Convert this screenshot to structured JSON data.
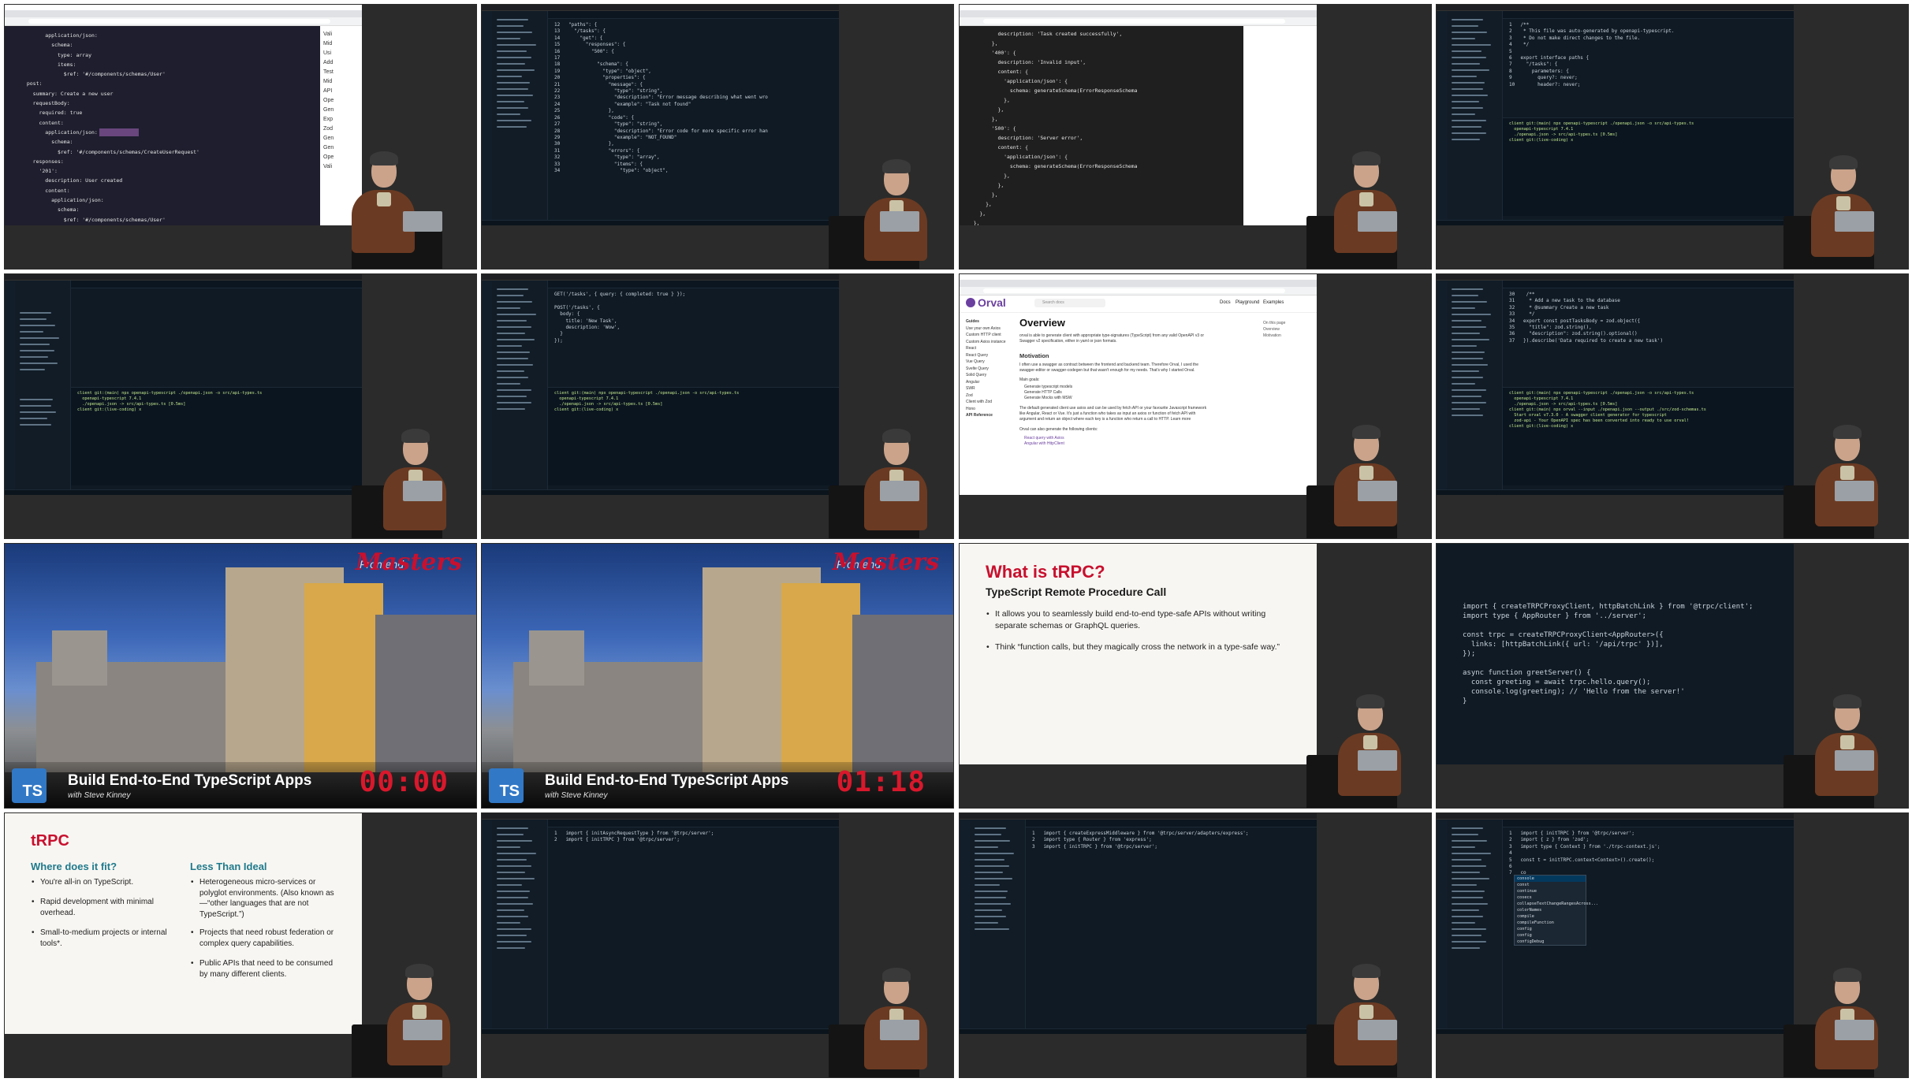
{
  "tiles": {
    "t1": {
      "code": [
        "        application/json:",
        "          schema:",
        "            type: array",
        "            items:",
        "              $ref: '#/components/schemas/User'",
        "  post:",
        "    summary: Create a new user",
        "    requestBody:",
        "      required: true",
        "      content:",
        "        application/json:",
        "          schema:",
        "            $ref: '#/components/schemas/CreateUserRequest'",
        "    responses:",
        "      '201':",
        "        description: User created",
        "        content:",
        "          application/json:",
        "            schema:",
        "              $ref: '#/components/schemas/User'"
      ],
      "side_labels": [
        "Vali",
        "Mid",
        "Usi",
        "Add",
        "Test",
        "Mid",
        "API",
        "Ope",
        "Gen",
        "Exp",
        "Zod",
        "Gen",
        "Gen",
        "Ope",
        "Vali"
      ]
    },
    "t2": {
      "code": [
        "12   \"paths\": {",
        "13     \"/tasks\": {",
        "14       \"get\": {",
        "15         \"responses\": {",
        "16           \"500\": {",
        "17",
        "18             \"schema\": {",
        "19               \"type\": \"object\",",
        "20               \"properties\": {",
        "21                 \"message\": {",
        "22                   \"type\": \"string\",",
        "23                   \"description\": \"Error message describing what went wro",
        "24                   \"example\": \"Task not found\"",
        "25                 },",
        "26                 \"code\": {",
        "27                   \"type\": \"string\",",
        "28                   \"description\": \"Error code for more specific error han",
        "29                   \"example\": \"NOT_FOUND\"",
        "30                 },",
        "31                 \"errors\": {",
        "32                   \"type\": \"array\",",
        "33                   \"items\": {",
        "34                     \"type\": \"object\","
      ]
    },
    "t3": {
      "code": [
        "          description: 'Task created successfully',",
        "        },",
        "        '400': {",
        "          description: 'Invalid input',",
        "          content: {",
        "            'application/json': {",
        "              schema: generateSchema(ErrorResponseSchema",
        "            },",
        "          },",
        "        },",
        "        '500': {",
        "          description: 'Server error',",
        "          content: {",
        "            'application/json': {",
        "              schema: generateSchema(ErrorResponseSchema",
        "            },",
        "          },",
        "        },",
        "      },",
        "    },",
        "  },"
      ]
    },
    "t4": {
      "code": [
        "1   /**",
        "2    * This file was auto-generated by openapi-typescript.",
        "3    * Do not make direct changes to the file.",
        "4    */",
        "5",
        "6   export interface paths {",
        "7     \"/tasks\": {",
        "8       parameters: {",
        "9         query?: never;",
        "10        header?: never;"
      ],
      "terminal": [
        "client git:(main) npx openapi-typescript ./openapi.json -o src/api-types.ts",
        "  openapi-typescript 7.4.1",
        "  ./openapi.json -> src/api-types.ts [0.5ms]",
        "client git:(live-coding) x"
      ]
    },
    "t5": {
      "terminal": [
        "client git:(main) npx openapi-typescript ./openapi.json -o src/api-types.ts",
        "  openapi-typescript 7.4.1",
        "  ./openapi.json -> src/api-types.ts [0.5ms]",
        "client git:(live-coding) x"
      ]
    },
    "t6": {
      "code": [
        "GET('/tasks', { query: { completed: true } });",
        "",
        "POST('/tasks', {",
        "  body: {",
        "    title: 'New Task',",
        "    description: 'Wow',",
        "  }",
        "});"
      ],
      "terminal": [
        "client git:(main) npx openapi-typescript ./openapi.json -o src/api-types.ts",
        "  openapi-typescript 7.4.1",
        "  ./openapi.json -> src/api-types.ts [0.5ms]",
        "client git:(live-coding) x"
      ]
    },
    "t7": {
      "brand": "Orval",
      "search_placeholder": "Search docs",
      "nav": [
        "Docs",
        "Playground",
        "Examples"
      ],
      "sidebar": [
        "Guides",
        "Use your own Axios",
        "Custom HTTP client",
        "Custom Axios instance",
        "React",
        "React Query",
        "Vue Query",
        "Svelte Query",
        "Solid Query",
        "Angular",
        "SWR",
        "Zod",
        "Client with Zod",
        "Hono",
        "API Reference"
      ],
      "heading": "Overview",
      "intro": "orval is able to generate client with appropriate type-signatures (TypeScript) from any valid OpenAPI v3 or Swagger v2 specification, either in yaml or json formats.",
      "motivation_title": "Motivation",
      "motivation": "I often use a swagger as contract between the frontend and backend team. Therefore Orval, I used the swagger-editor or swagger-codegen but that wasn't enough for my needs. That's why I started Orval.",
      "goals_title": "Main goals:",
      "goals": [
        "Generate typescript models",
        "Generate HTTP Calls",
        "Generate Mocks with MSW"
      ],
      "body": "The default generated client use axios and can be used by fetch API or your favourite Javascript framework like Angular, React or Vue. It's just a function who takes as input an axios or function of fetch API with argument and return an object where each key is a function who return a call to HTTP. Learn more",
      "also": "Orval can also generate the following clients:",
      "clients": [
        "React query with Axios",
        "Angular with HttpClient"
      ],
      "toc": [
        "On this page",
        "Overview",
        "Motivation"
      ]
    },
    "t8": {
      "code": [
        "30    /**",
        "31     * Add a new task to the database",
        "32     * @summary Create a new task",
        "33     */",
        "34   export const postTasksBody = zod.object({",
        "35     \"title\": zod.string(),",
        "36     \"description\": zod.string().optional()",
        "37   }).describe('Data required to create a new task')"
      ],
      "terminal": [
        "client git:(main) npx openapi-typescript ./openapi.json -o src/api-types.ts",
        "  openapi-typescript 7.4.1",
        "  ./openapi.json -> src/api-types.ts [0.5ms]",
        "client git:(main) npx orval --input ./openapi.json --output ./src/zod-schemas.ts",
        "  Start orval v7.3.0 - A swagger client generator for typescript",
        "  zod-api - Your OpenAPI spec has been converted into ready to use orval!",
        "client git:(live-coding) x"
      ]
    },
    "t9": {
      "course_title": "Build End-to-End TypeScript Apps",
      "course_sub": "with Steve Kinney",
      "timer": "00:00",
      "logo_text": "TS",
      "brand_a": "Frontend",
      "brand_b": "Masters"
    },
    "t10": {
      "course_title": "Build End-to-End TypeScript Apps",
      "course_sub": "with Steve Kinney",
      "timer": "01:18",
      "logo_text": "TS",
      "brand_a": "Frontend",
      "brand_b": "Masters"
    },
    "t11": {
      "title": "What is tRPC?",
      "subtitle": "TypeScript Remote Procedure Call",
      "bullets": [
        "It allows you to seamlessly build end-to-end type-safe APIs without writing separate schemas or GraphQL queries.",
        "Think “function calls, but they magically cross the network in a type-safe way.”"
      ]
    },
    "t12": {
      "code": [
        "import { createTRPCProxyClient, httpBatchLink } from '@trpc/client';",
        "import type { AppRouter } from '../server';",
        "",
        "const trpc = createTRPCProxyClient<AppRouter>({",
        "  links: [httpBatchLink({ url: '/api/trpc' })],",
        "});",
        "",
        "async function greetServer() {",
        "  const greeting = await trpc.hello.query();",
        "  console.log(greeting); // 'Hello from the server!'",
        "}"
      ]
    },
    "t13": {
      "title": "tRPC",
      "left_heading": "Where does it fit?",
      "left": [
        "You're all-in on TypeScript.",
        "Rapid development with minimal overhead.",
        "Small-to-medium projects or internal tools*."
      ],
      "right_heading": "Less Than Ideal",
      "right": [
        "Heterogeneous micro-services or polyglot environments. (Also known as—“other languages that are not TypeScript.”)",
        "Projects that need robust federation or complex query capabilities.",
        "Public APIs that need to be consumed by many different clients."
      ]
    },
    "t14": {
      "code": [
        "1   import { initAsyncRequestType } from '@trpc/server';",
        "2   import { initTRPC } from '@trpc/server';"
      ]
    },
    "t15": {
      "code": [
        "1   import { createExpressMiddleware } from '@trpc/server/adapters/express';",
        "2   import type { Router } from 'express';",
        "3   import { initTRPC } from '@trpc/server';"
      ]
    },
    "t16": {
      "code": [
        "1   import { initTRPC } from '@trpc/server';",
        "2   import { z } from 'zod';",
        "3   import type { Context } from './trpc-context.js';",
        "4",
        "5   const t = initTRPC.context<Context>().create();",
        "6",
        "7   co"
      ],
      "autocomplete": [
        "console",
        "const",
        "continue",
        "cosecs",
        "collapseTextChangeRangesAcross...",
        "colorNames",
        "compile",
        "compileFunction",
        "config",
        "config",
        "configDebug"
      ]
    }
  }
}
